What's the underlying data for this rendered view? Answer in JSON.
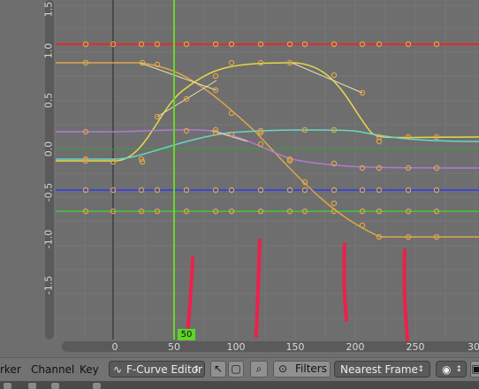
{
  "graph": {
    "y_labels": [
      "1.5",
      "1.0",
      "0.5",
      "0.0",
      "-0.5",
      "-1.0",
      "-1.5"
    ],
    "x_labels": [
      "0",
      "50",
      "100",
      "150",
      "200",
      "250",
      "30"
    ],
    "current_frame": "50",
    "colors": {
      "grid": "#757575",
      "current_frame_line": "#6dd52c",
      "curve_red": "#e22b2b",
      "curve_orange": "#e0a64a",
      "curve_yellow": "#e6d84c",
      "curve_purple": "#b279d4",
      "curve_blue": "#3f46d1",
      "curve_green": "#43c93c",
      "curve_cyan": "#6ad6c2",
      "annotation": "#ef1f4b"
    }
  },
  "header": {
    "menu_marker": "rker",
    "menu_channel": "Channel",
    "menu_key": "Key",
    "editor_mode": "F-Curve Editor",
    "filters_label": "Filters",
    "snap_mode": "Nearest Frame"
  }
}
